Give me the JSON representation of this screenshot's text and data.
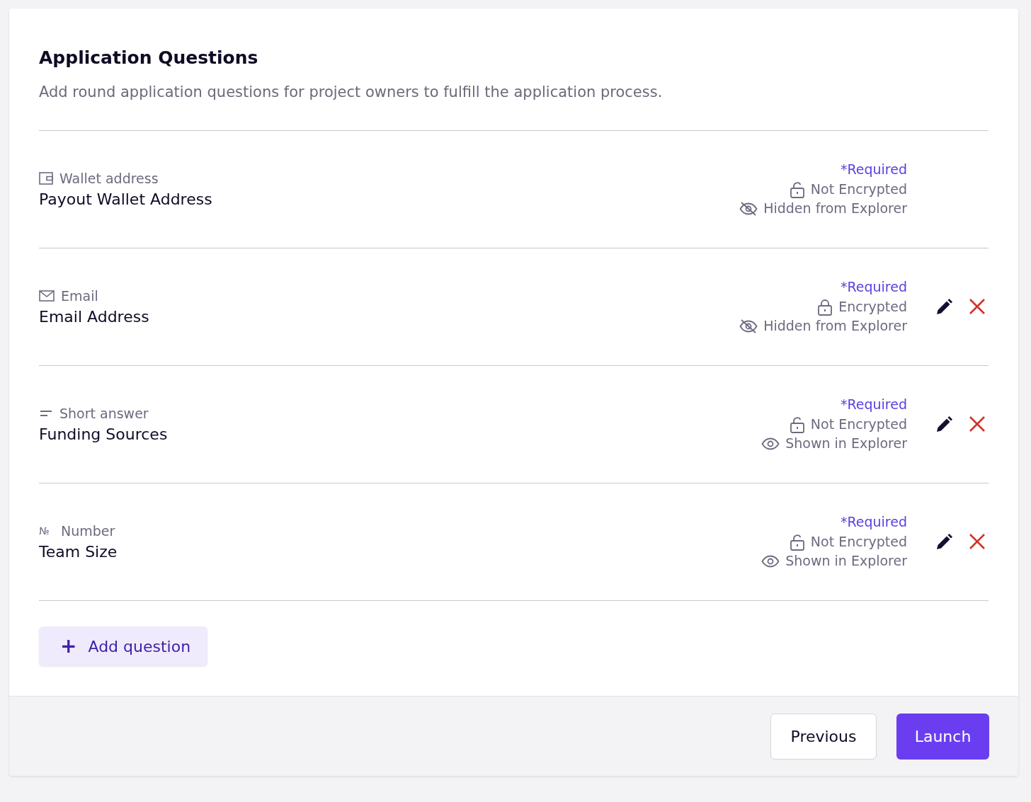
{
  "title": "Application Questions",
  "description": "Add round application questions for project owners to fulfill the application process.",
  "questions": [
    {
      "kind": "wallet",
      "type_label": "Wallet address",
      "title": "Payout Wallet Address",
      "required": true,
      "required_label": "*Required",
      "encrypted": false,
      "encryption_label": "Not Encrypted",
      "shown": false,
      "visibility_label": "Hidden from Explorer",
      "editable": false
    },
    {
      "kind": "email",
      "type_label": "Email",
      "title": "Email Address",
      "required": true,
      "required_label": "*Required",
      "encrypted": true,
      "encryption_label": "Encrypted",
      "shown": false,
      "visibility_label": "Hidden from Explorer",
      "editable": true
    },
    {
      "kind": "short",
      "type_label": "Short answer",
      "title": "Funding Sources",
      "required": true,
      "required_label": "*Required",
      "encrypted": false,
      "encryption_label": "Not Encrypted",
      "shown": true,
      "visibility_label": "Shown in Explorer",
      "editable": true
    },
    {
      "kind": "number",
      "symbol": "№",
      "type_label": "Number",
      "title": "Team Size",
      "required": true,
      "required_label": "*Required",
      "encrypted": false,
      "encryption_label": "Not Encrypted",
      "shown": true,
      "visibility_label": "Shown in Explorer",
      "editable": true
    }
  ],
  "add_button": {
    "icon": "+",
    "label": "Add question"
  },
  "footer": {
    "previous": "Previous",
    "launch": "Launch"
  }
}
